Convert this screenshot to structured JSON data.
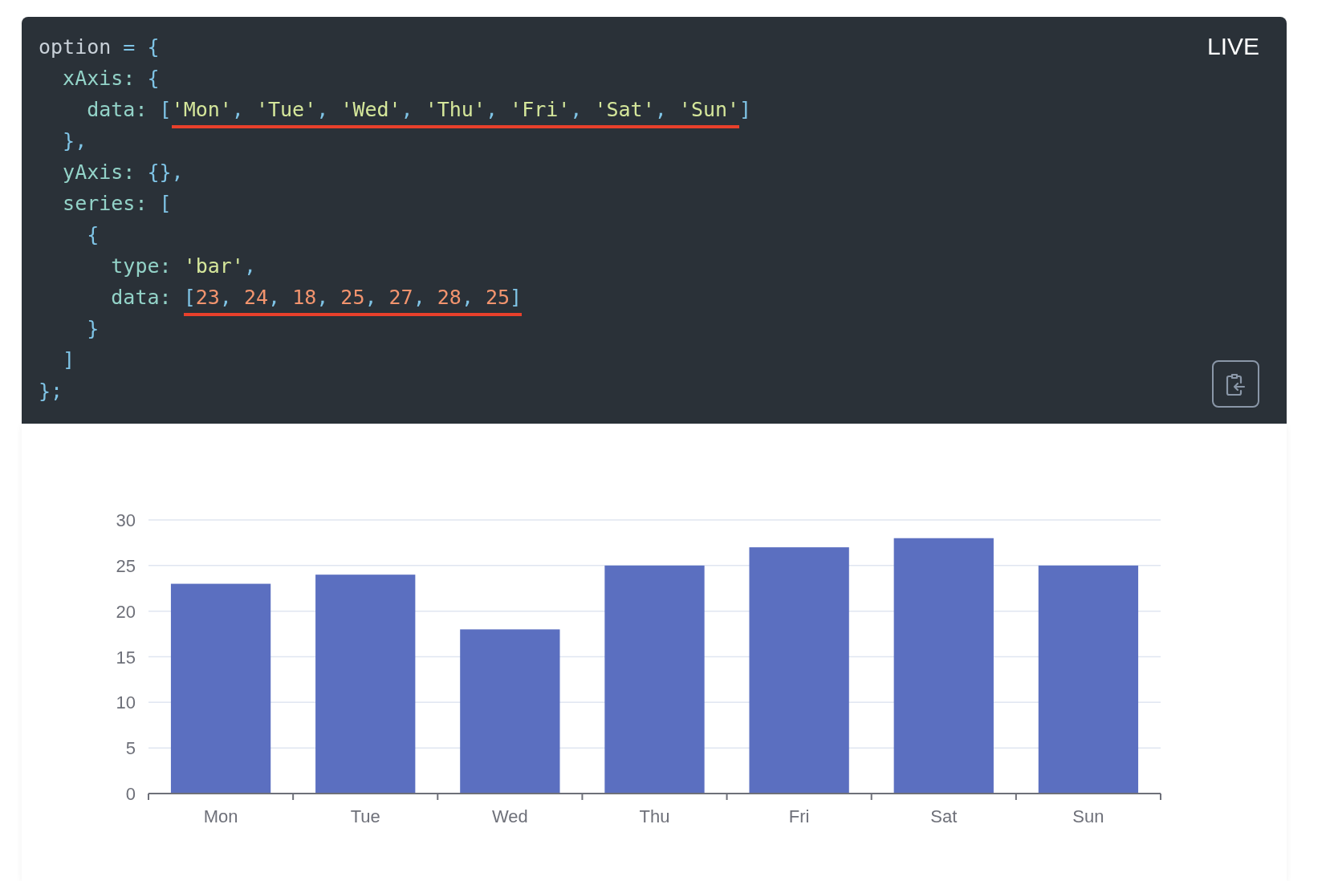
{
  "code_panel": {
    "badge": "LIVE",
    "lines": [
      [
        {
          "underlined": false,
          "tokens": [
            {
              "kind": "plain",
              "text": "option "
            },
            {
              "kind": "punct",
              "text": "= {"
            }
          ]
        }
      ],
      [
        {
          "underlined": false,
          "tokens": [
            {
              "kind": "key",
              "text": "  xAxis: "
            },
            {
              "kind": "punct",
              "text": "{"
            }
          ]
        }
      ],
      [
        {
          "underlined": false,
          "tokens": [
            {
              "kind": "key",
              "text": "    data: "
            },
            {
              "kind": "punct",
              "text": "["
            }
          ]
        },
        {
          "underlined": true,
          "tokens": [
            {
              "kind": "string",
              "text": "'Mon'"
            },
            {
              "kind": "punct",
              "text": ", "
            },
            {
              "kind": "string",
              "text": "'Tue'"
            },
            {
              "kind": "punct",
              "text": ", "
            },
            {
              "kind": "string",
              "text": "'Wed'"
            },
            {
              "kind": "punct",
              "text": ", "
            },
            {
              "kind": "string",
              "text": "'Thu'"
            },
            {
              "kind": "punct",
              "text": ", "
            },
            {
              "kind": "string",
              "text": "'Fri'"
            },
            {
              "kind": "punct",
              "text": ", "
            },
            {
              "kind": "string",
              "text": "'Sat'"
            },
            {
              "kind": "punct",
              "text": ", "
            },
            {
              "kind": "string",
              "text": "'Sun'"
            }
          ]
        },
        {
          "underlined": false,
          "tokens": [
            {
              "kind": "punct",
              "text": "]"
            }
          ]
        }
      ],
      [
        {
          "underlined": false,
          "tokens": [
            {
              "kind": "punct",
              "text": "  },"
            }
          ]
        }
      ],
      [
        {
          "underlined": false,
          "tokens": [
            {
              "kind": "key",
              "text": "  yAxis: "
            },
            {
              "kind": "punct",
              "text": "{},"
            }
          ]
        }
      ],
      [
        {
          "underlined": false,
          "tokens": [
            {
              "kind": "key",
              "text": "  series: "
            },
            {
              "kind": "punct",
              "text": "["
            }
          ]
        }
      ],
      [
        {
          "underlined": false,
          "tokens": [
            {
              "kind": "punct",
              "text": "    {"
            }
          ]
        }
      ],
      [
        {
          "underlined": false,
          "tokens": [
            {
              "kind": "key",
              "text": "      type: "
            },
            {
              "kind": "string",
              "text": "'bar'"
            },
            {
              "kind": "punct",
              "text": ","
            }
          ]
        }
      ],
      [
        {
          "underlined": false,
          "tokens": [
            {
              "kind": "key",
              "text": "      data: "
            }
          ]
        },
        {
          "underlined": true,
          "tokens": [
            {
              "kind": "punct",
              "text": "["
            },
            {
              "kind": "number",
              "text": "23"
            },
            {
              "kind": "punct",
              "text": ", "
            },
            {
              "kind": "number",
              "text": "24"
            },
            {
              "kind": "punct",
              "text": ", "
            },
            {
              "kind": "number",
              "text": "18"
            },
            {
              "kind": "punct",
              "text": ", "
            },
            {
              "kind": "number",
              "text": "25"
            },
            {
              "kind": "punct",
              "text": ", "
            },
            {
              "kind": "number",
              "text": "27"
            },
            {
              "kind": "punct",
              "text": ", "
            },
            {
              "kind": "number",
              "text": "28"
            },
            {
              "kind": "punct",
              "text": ", "
            },
            {
              "kind": "number",
              "text": "25"
            },
            {
              "kind": "punct",
              "text": "]"
            }
          ]
        }
      ],
      [
        {
          "underlined": false,
          "tokens": [
            {
              "kind": "punct",
              "text": "    }"
            }
          ]
        }
      ],
      [
        {
          "underlined": false,
          "tokens": [
            {
              "kind": "punct",
              "text": "  ]"
            }
          ]
        }
      ],
      [
        {
          "underlined": false,
          "tokens": [
            {
              "kind": "punct",
              "text": "};"
            }
          ]
        }
      ]
    ]
  },
  "chart_panel": {
    "chart_data": {
      "type": "bar",
      "categories": [
        "Mon",
        "Tue",
        "Wed",
        "Thu",
        "Fri",
        "Sat",
        "Sun"
      ],
      "series": [
        {
          "color": "#5b6fc0",
          "values": [
            23,
            24,
            18,
            25,
            27,
            28,
            25
          ]
        }
      ],
      "grid": true,
      "ylim": [
        0,
        30
      ],
      "yticks": [
        0,
        5,
        10,
        15,
        20,
        25,
        30
      ]
    }
  }
}
